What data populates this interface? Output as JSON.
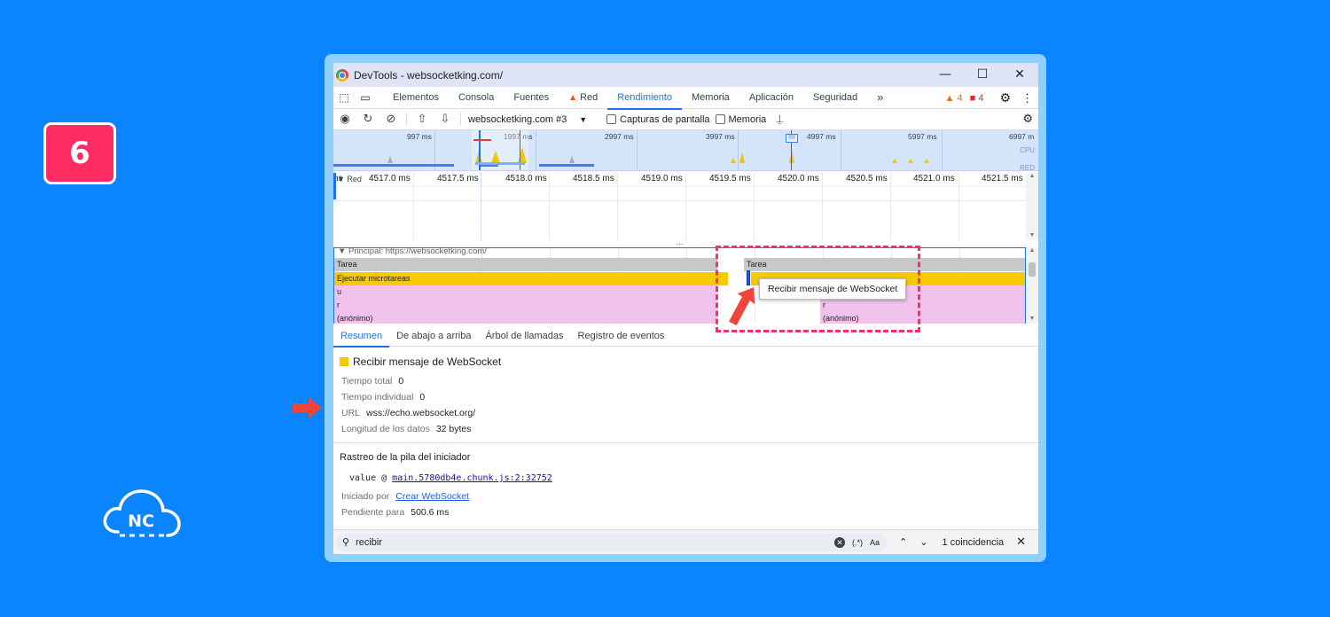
{
  "step_number": "6",
  "logo_text": "NC",
  "window": {
    "title": "DevTools - websocketking.com/",
    "controls": {
      "minimize": "—",
      "maximize": "☐",
      "close": "✕"
    }
  },
  "tabs": [
    {
      "label": "Elementos"
    },
    {
      "label": "Consola"
    },
    {
      "label": "Fuentes"
    },
    {
      "label": "Red",
      "warning": true
    },
    {
      "label": "Rendimiento",
      "active": true
    },
    {
      "label": "Memoria"
    },
    {
      "label": "Aplicación"
    },
    {
      "label": "Seguridad"
    }
  ],
  "tabs_more": "»",
  "warnings_count": "4",
  "errors_count": "4",
  "toolbar": {
    "target_select": "websocketking.com #3",
    "screenshots_label": "Capturas de pantalla",
    "memory_label": "Memoria"
  },
  "overview": {
    "ticks": [
      "997 ms",
      "1997 ms",
      "2997 ms",
      "3997 ms",
      "4997 ms",
      "5997 ms",
      "6997 m"
    ],
    "cpu_label": "CPU",
    "net_label": "RED"
  },
  "ruler_ticks": [
    "ns",
    "4517.0 ms",
    "4517.5 ms",
    "4518.0 ms",
    "4518.5 ms",
    "4519.0 ms",
    "4519.5 ms",
    "4520.0 ms",
    "4520.5 ms",
    "4521.0 ms",
    "4521.5 ms"
  ],
  "network_track": "Red",
  "flame": {
    "title": "▼ Principal: https://websocketking.com/",
    "task_label": "Tarea",
    "task_label_2": "Tarea",
    "microtasks_label": "Ejecutar microtareas",
    "row_u": "u",
    "row_r": "r",
    "row_r2": "r",
    "anon_label": "(anónimo)",
    "anon_label_2": "(anónimo)"
  },
  "tooltip": "Recibir mensaje de WebSocket",
  "detail_tabs": [
    "Resumen",
    "De abajo a arriba",
    "Árbol de llamadas",
    "Registro de eventos"
  ],
  "summary": {
    "event_title": "Recibir mensaje de WebSocket",
    "total_time_label": "Tiempo total",
    "total_time_value": "0",
    "self_time_label": "Tiempo individual",
    "self_time_value": "0",
    "url_label": "URL",
    "url_value": "wss://echo.websocket.org/",
    "data_length_label": "Longitud de los datos",
    "data_length_value": "32 bytes",
    "stack_title": "Rastreo de la pila del iniciador",
    "stack_fn": "value @ ",
    "stack_link": "main.5780db4e.chunk.js:2:32752",
    "initiated_label": "Iniciado por",
    "initiated_link": "Crear WebSocket",
    "pending_label": "Pendiente para",
    "pending_value": "500.6 ms"
  },
  "search": {
    "query": "recibir",
    "regex_toggle": "(.*)",
    "case_toggle": "Aa",
    "match_count": "1 coincidencia"
  },
  "colors": {
    "background": "#0a84ff",
    "badge": "#ff2d63",
    "highlight": "#ff2d63",
    "arrow": "#f0453a",
    "microtask": "#f9c900",
    "function_call": "#f1c3ec",
    "task": "#c8c8c8",
    "accent": "#1a73e8"
  }
}
